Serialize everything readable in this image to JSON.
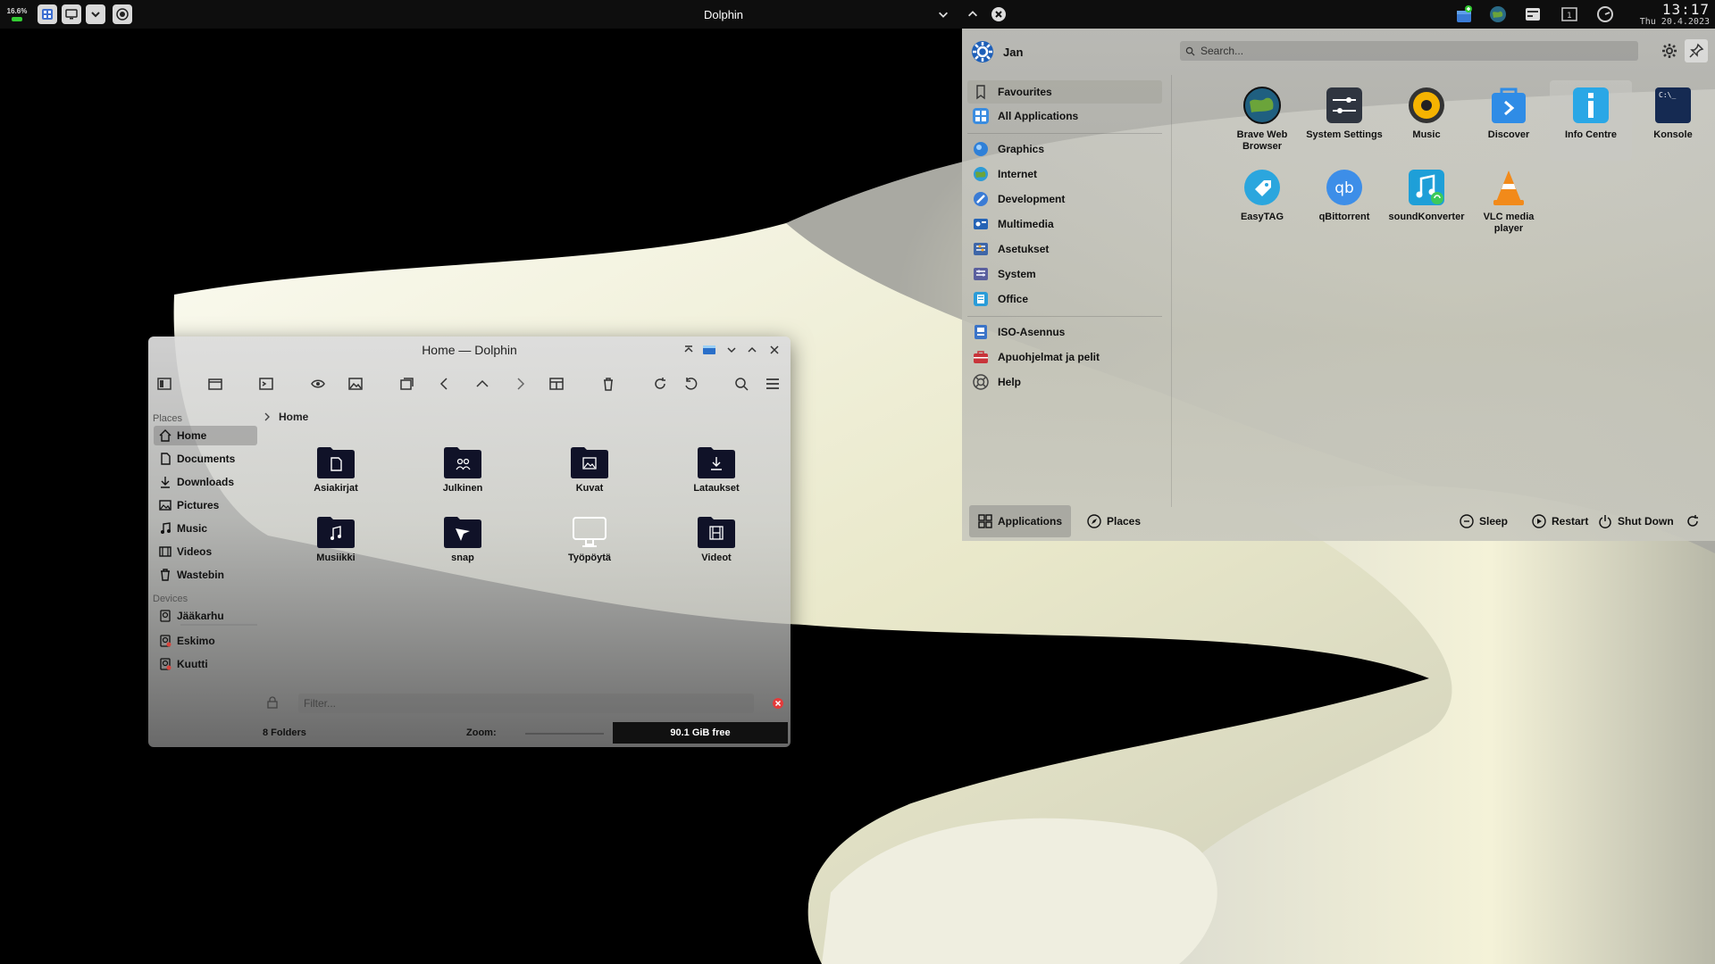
{
  "panel": {
    "cpu_readout": "16.6%",
    "window_title": "Dolphin",
    "clock_time": "13:17",
    "clock_date": "Thu 20.4.2023"
  },
  "dolphin": {
    "title": "Home — Dolphin",
    "breadcrumb": "Home",
    "places_heading": "Places",
    "devices_heading": "Devices",
    "places": [
      {
        "label": "Home",
        "icon": "home-icon"
      },
      {
        "label": "Documents",
        "icon": "documents-icon"
      },
      {
        "label": "Downloads",
        "icon": "downloads-icon"
      },
      {
        "label": "Pictures",
        "icon": "pictures-icon"
      },
      {
        "label": "Music",
        "icon": "music-icon"
      },
      {
        "label": "Videos",
        "icon": "videos-icon"
      },
      {
        "label": "Wastebin",
        "icon": "trash-icon"
      }
    ],
    "devices": [
      {
        "label": "Jääkarhu",
        "icon": "drive-icon"
      },
      {
        "label": "Eskimo",
        "icon": "drive-icon"
      },
      {
        "label": "Kuutti",
        "icon": "drive-icon"
      }
    ],
    "folders": [
      {
        "label": "Asiakirjat",
        "icon": "folder-documents-icon"
      },
      {
        "label": "Julkinen",
        "icon": "folder-public-icon"
      },
      {
        "label": "Kuvat",
        "icon": "folder-pictures-icon"
      },
      {
        "label": "Lataukset",
        "icon": "folder-downloads-icon"
      },
      {
        "label": "Musiikki",
        "icon": "folder-music-icon"
      },
      {
        "label": "snap",
        "icon": "folder-snap-icon"
      },
      {
        "label": "Työpöytä",
        "icon": "desktop-icon"
      },
      {
        "label": "Videot",
        "icon": "folder-videos-icon"
      }
    ],
    "filter_placeholder": "Filter...",
    "status_folders": "8 Folders",
    "zoom_label": "Zoom:",
    "free_space": "90.1 GiB free"
  },
  "launcher": {
    "user_name": "Jan",
    "search_placeholder": "Search...",
    "categories": [
      {
        "label": "Favourites",
        "color": "#eeeeee"
      },
      {
        "label": "All Applications",
        "color": "#3b8de0"
      },
      {
        "label": "Graphics",
        "color": "#2f80d8"
      },
      {
        "label": "Internet",
        "color": "#2e9bd6"
      },
      {
        "label": "Development",
        "color": "#3a7bd5"
      },
      {
        "label": "Multimedia",
        "color": "#2463b5"
      },
      {
        "label": "Asetukset",
        "color": "#3e66a8"
      },
      {
        "label": "System",
        "color": "#5a5f9e"
      },
      {
        "label": "Office",
        "color": "#2a9cd8"
      },
      {
        "label": "ISO-Asennus",
        "color": "#3b74c8"
      },
      {
        "label": "Apuohjelmat ja pelit",
        "color": "#c8343a"
      },
      {
        "label": "Help",
        "color": "#7a8090"
      }
    ],
    "apps": [
      {
        "label": "Brave Web Browser",
        "icon": "brave-globe-icon"
      },
      {
        "label": "System Settings",
        "icon": "system-settings-icon"
      },
      {
        "label": "Music",
        "icon": "music-player-icon"
      },
      {
        "label": "Discover",
        "icon": "discover-icon"
      },
      {
        "label": "Info Centre",
        "icon": "info-centre-icon"
      },
      {
        "label": "Konsole",
        "icon": "konsole-icon"
      },
      {
        "label": "EasyTAG",
        "icon": "easytag-icon"
      },
      {
        "label": "qBittorrent",
        "icon": "qbittorrent-icon"
      },
      {
        "label": "soundKonverter",
        "icon": "soundkonverter-icon"
      },
      {
        "label": "VLC media player",
        "icon": "vlc-icon"
      }
    ],
    "footer": {
      "applications": "Applications",
      "places": "Places",
      "sleep": "Sleep",
      "restart": "Restart",
      "shut_down": "Shut Down"
    }
  }
}
